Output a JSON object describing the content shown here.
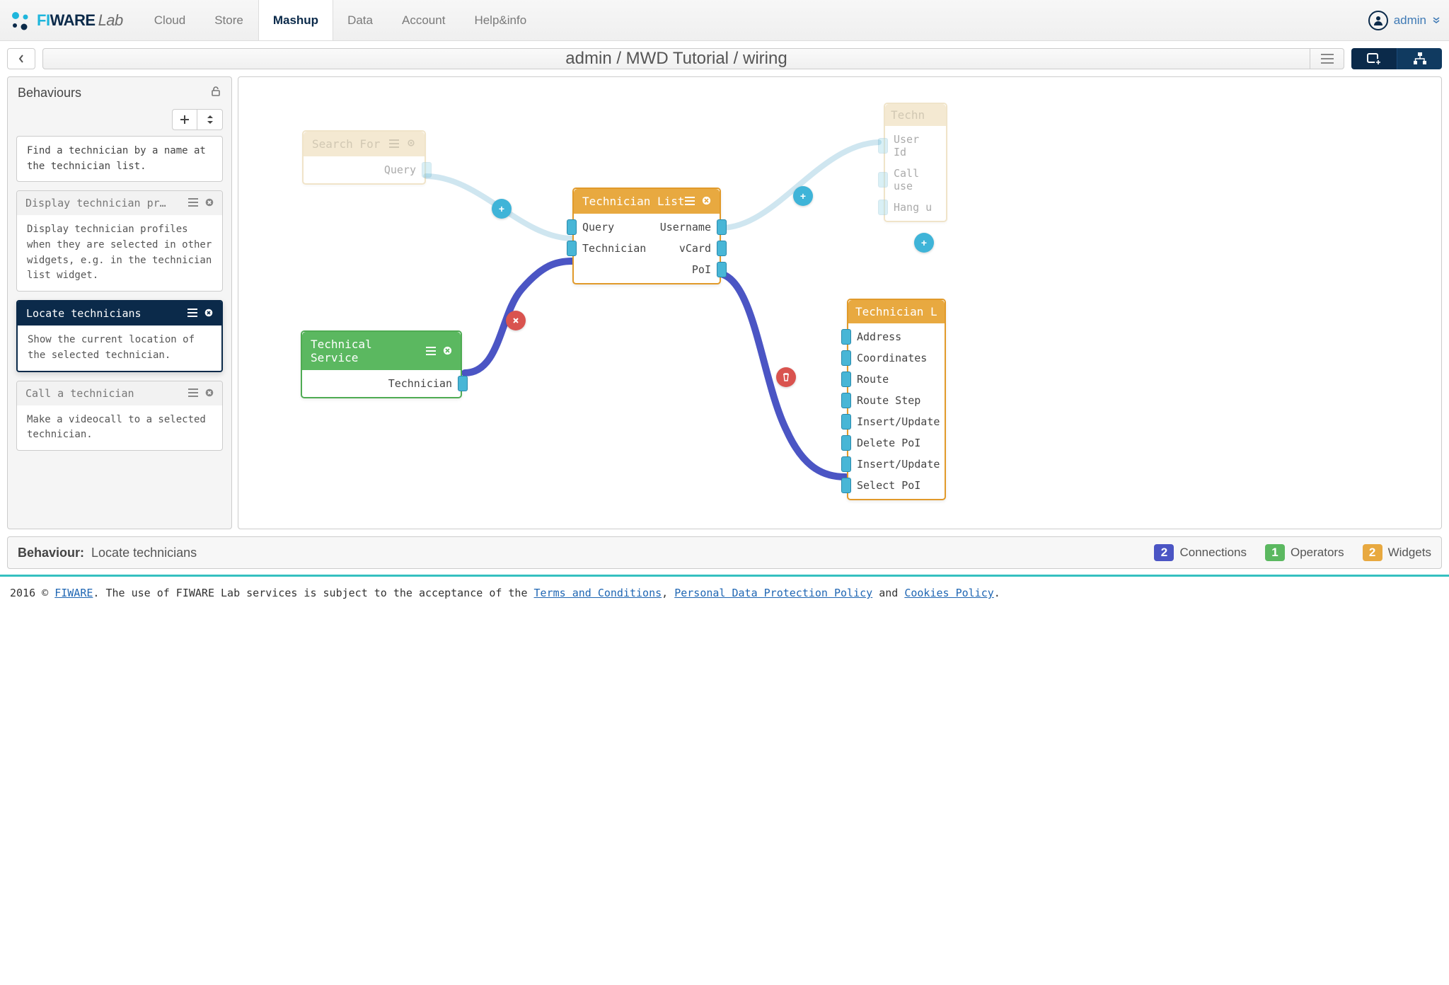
{
  "nav": {
    "items": [
      "Cloud",
      "Store",
      "Mashup",
      "Data",
      "Account",
      "Help&info"
    ],
    "active_index": 2,
    "user": "admin"
  },
  "breadcrumb": "admin / MWD Tutorial / wiring",
  "sidebar": {
    "title": "Behaviours",
    "items": [
      {
        "title": "",
        "body": "Find a technician by a name at the technician list.",
        "partial": true
      },
      {
        "title": "Display technician pr…",
        "body": "Display technician profiles when they are selected in other widgets, e.g. in the technician list widget."
      },
      {
        "title": "Locate technicians",
        "body": "Show the current location of the selected technician.",
        "selected": true
      },
      {
        "title": "Call a technician",
        "body": "Make a videocall to a selected technician."
      }
    ]
  },
  "nodes": {
    "search_for": {
      "title": "Search For",
      "outputs": [
        "Query"
      ]
    },
    "technical_service": {
      "title": "Technical Service",
      "outputs": [
        "Technician"
      ]
    },
    "technician_list": {
      "title": "Technician List",
      "inputs": [
        "Query",
        "Technician"
      ],
      "outputs": [
        "Username",
        "vCard",
        "PoI"
      ]
    },
    "techn_partial": {
      "title": "Techn",
      "inputs": [
        "User Id",
        "Call use",
        "Hang u"
      ]
    },
    "technician_l": {
      "title": "Technician L",
      "inputs": [
        "Address",
        "Coordinates",
        "Route",
        "Route Step",
        "Insert/Update",
        "Delete PoI",
        "Insert/Update",
        "Select PoI"
      ]
    }
  },
  "status": {
    "label": "Behaviour:",
    "value": "Locate technicians",
    "connections": {
      "count": "2",
      "label": "Connections"
    },
    "operators": {
      "count": "1",
      "label": "Operators"
    },
    "widgets": {
      "count": "2",
      "label": "Widgets"
    }
  },
  "footer": {
    "prefix": "2016 © ",
    "fiware": "FIWARE",
    "mid1": ". The use of FIWARE Lab services is subject to the acceptance of the ",
    "terms": "Terms and Conditions",
    "sep1": ", ",
    "privacy": "Personal Data Protection Policy",
    "sep2": " and ",
    "cookies": "Cookies Policy",
    "suffix": "."
  }
}
